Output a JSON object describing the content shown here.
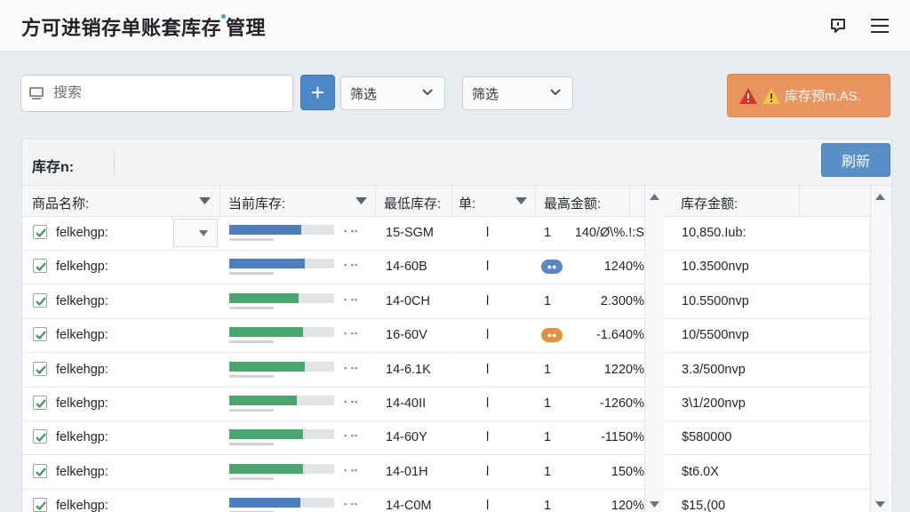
{
  "app": {
    "title": "方可进销存单账套库存",
    "title_suffix": "管理"
  },
  "toolbar": {
    "search_placeholder": "搜索",
    "add_label": "+",
    "filter1": "筛选",
    "filter2": "筛选",
    "warning": "库存预​m.AS."
  },
  "panel": {
    "label": "库存n:",
    "refresh": "刷新"
  },
  "columns": {
    "name": "商品名称:",
    "stock": "当前库存:",
    "min": "最低库存:",
    "unit": "单:",
    "max": "最高金额:",
    "amount": "库存金额:"
  },
  "colors": {
    "accent": "#4c88c7",
    "warning": "#e9955f",
    "bar_blue": "#4d7fbe",
    "bar_green": "#4aa66e",
    "check": "#3a9a52"
  },
  "rows": [
    {
      "name": "felkehgp:",
      "stock_pct": 0.69,
      "bar": "blue",
      "min": "15-SGM",
      "unit": "l",
      "one": "1",
      "max": "140/Ø\\%.!:S",
      "amount": "10,850.Iub:",
      "badge": ""
    },
    {
      "name": "felkehgp:",
      "stock_pct": 0.72,
      "bar": "blue",
      "min": "14-60B",
      "unit": "l",
      "one": "",
      "max": "1240%",
      "amount": "10.3500nvp",
      "badge": "blue"
    },
    {
      "name": "felkehgp:",
      "stock_pct": 0.66,
      "bar": "green",
      "min": "14-0CH",
      "unit": "l",
      "one": "1",
      "max": "2.300%",
      "amount": "10.5500nvp",
      "badge": ""
    },
    {
      "name": "felkehgp:",
      "stock_pct": 0.7,
      "bar": "green",
      "min": "16-60V",
      "unit": "l",
      "one": "",
      "max": "-1.640%",
      "amount": "10/5500nvp",
      "badge": "orange"
    },
    {
      "name": "felkehgp:",
      "stock_pct": 0.72,
      "bar": "green",
      "min": "14-6.1K",
      "unit": "l",
      "one": "1",
      "max": "1220%",
      "amount": "3.3/500nvp",
      "badge": ""
    },
    {
      "name": "felkehgp:",
      "stock_pct": 0.64,
      "bar": "green",
      "min": "14-40II",
      "unit": "l",
      "one": "1",
      "max": "-1260%",
      "amount": "3\\1/200nvp",
      "badge": ""
    },
    {
      "name": "felkehgp:",
      "stock_pct": 0.7,
      "bar": "green",
      "min": "14-60Y",
      "unit": "l",
      "one": "1",
      "max": "-1150%",
      "amount": "$580000",
      "badge": ""
    },
    {
      "name": "felkehgp:",
      "stock_pct": 0.7,
      "bar": "green",
      "min": "14-01H",
      "unit": "l",
      "one": "1",
      "max": "150%",
      "amount": "$t6.0X",
      "badge": ""
    },
    {
      "name": "felkehgp:",
      "stock_pct": 0.68,
      "bar": "blue",
      "min": "14-C0M",
      "unit": "l",
      "one": "1",
      "max": "120%",
      "amount": "$15,(00",
      "badge": ""
    }
  ],
  "icons": [
    "chat-icon",
    "menu-icon",
    "search-icon",
    "chevron-down-icon",
    "warning-icon",
    "checkbox-check-icon",
    "scroll-up-icon",
    "scroll-down-icon"
  ]
}
